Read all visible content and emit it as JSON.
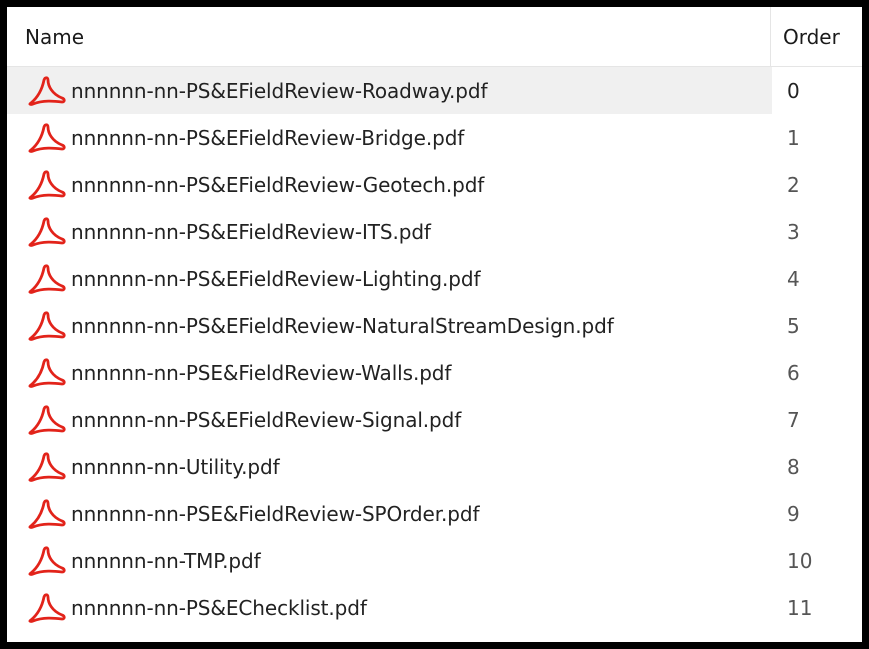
{
  "columns": {
    "name": "Name",
    "order": "Order"
  },
  "icon": "pdf-file-icon",
  "accent_color": "#e2231a",
  "rows": [
    {
      "name": "nnnnnn-nn-PS&EFieldReview-Roadway.pdf",
      "order": "0",
      "selected": true
    },
    {
      "name": "nnnnnn-nn-PS&EFieldReview-Bridge.pdf",
      "order": "1"
    },
    {
      "name": "nnnnnn-nn-PS&EFieldReview-Geotech.pdf",
      "order": "2"
    },
    {
      "name": "nnnnnn-nn-PS&EFieldReview-ITS.pdf",
      "order": "3"
    },
    {
      "name": "nnnnnn-nn-PS&EFieldReview-Lighting.pdf",
      "order": "4"
    },
    {
      "name": "nnnnnn-nn-PS&EFieldReview-NaturalStreamDesign.pdf",
      "order": "5"
    },
    {
      "name": "nnnnnn-nn-PSE&FieldReview-Walls.pdf",
      "order": "6"
    },
    {
      "name": "nnnnnn-nn-PS&EFieldReview-Signal.pdf",
      "order": "7"
    },
    {
      "name": "nnnnnn-nn-Utility.pdf",
      "order": "8"
    },
    {
      "name": "nnnnnn-nn-PSE&FieldReview-SPOrder.pdf",
      "order": "9"
    },
    {
      "name": "nnnnnn-nn-TMP.pdf",
      "order": "10"
    },
    {
      "name": "nnnnnn-nn-PS&EChecklist.pdf",
      "order": "11"
    }
  ]
}
